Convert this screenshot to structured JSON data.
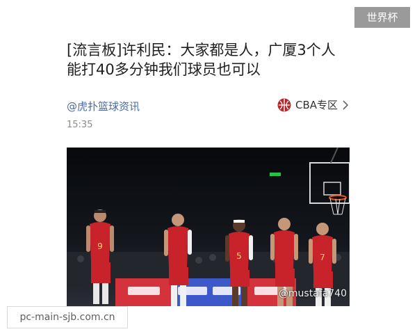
{
  "corner_tag": "世界杯",
  "article": {
    "title_line1": "[流言板]许利民：大家都是人，广厦3个人",
    "title_line2": "能打40多分钟我们球员也可以",
    "source": "@虎扑篮球资讯",
    "section_label": "CBA专区",
    "time": "15:35"
  },
  "photo": {
    "jersey_numbers": [
      "9",
      "",
      "5",
      "",
      "7"
    ],
    "watermark_handle": "@mustafa740"
  },
  "site_tag": "pc-main-sjb.com.cn",
  "icons": [
    "cba-logo-icon",
    "chevron-right-icon"
  ],
  "colors": {
    "jersey_red": "#c8232b",
    "source_link": "#4b6aa0"
  }
}
